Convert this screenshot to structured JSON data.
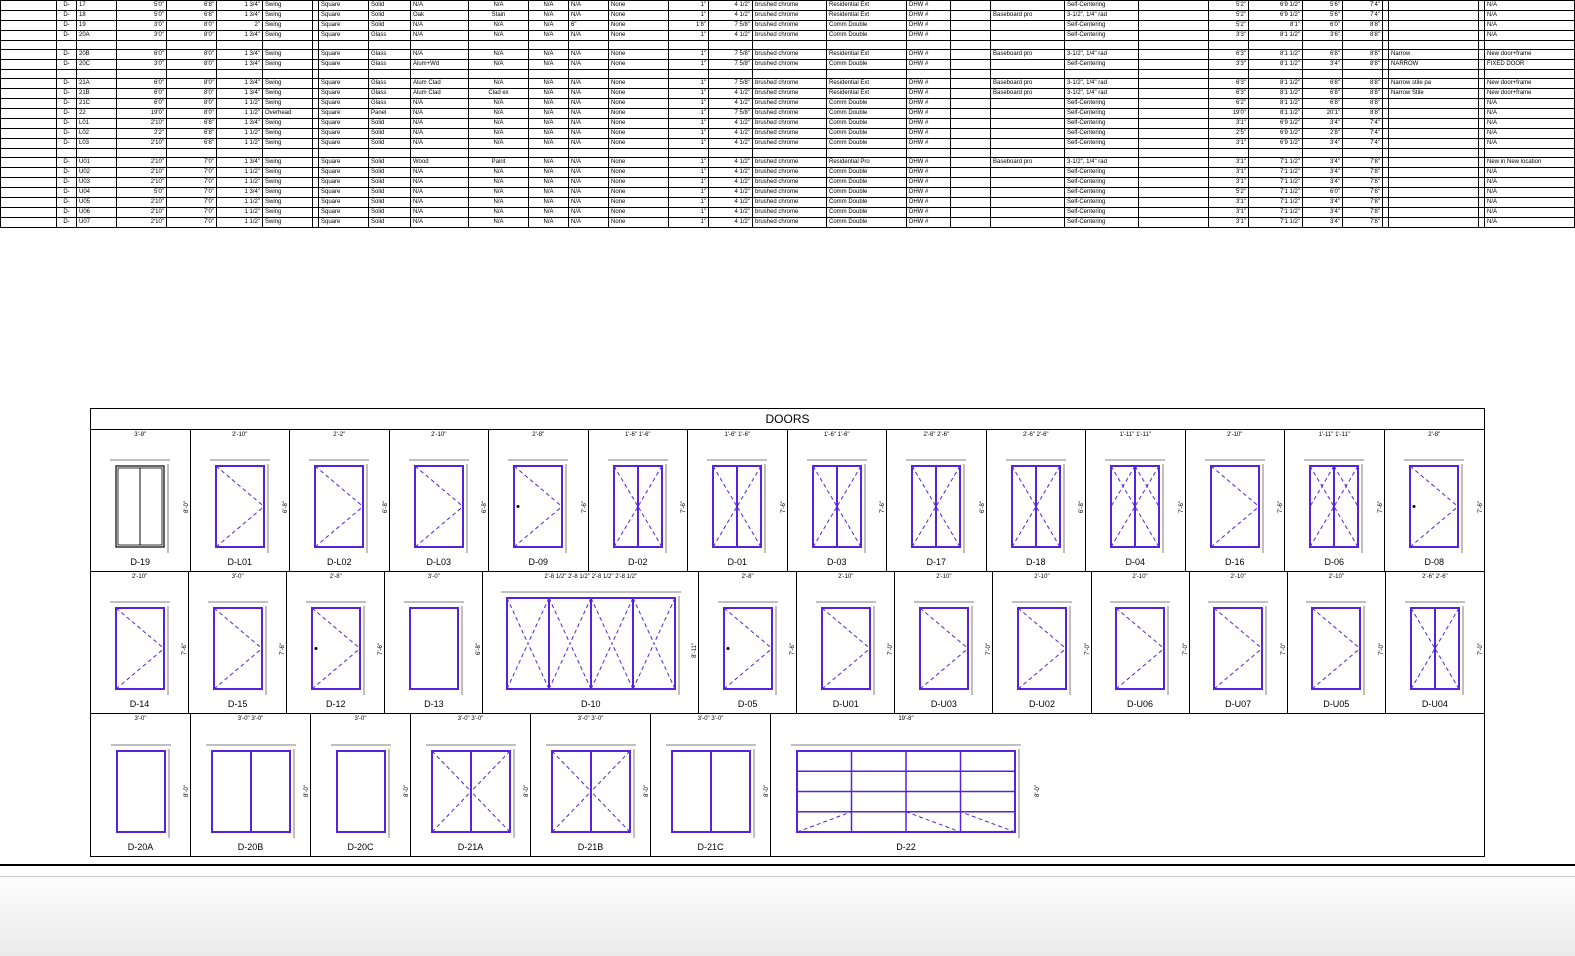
{
  "title": "DOORS",
  "schedule_rows": [
    {
      "p": "D-",
      "n": "17",
      "w": "5'0\"",
      "h": "6'8\"",
      "t": "1 3/4\"",
      "op": "Swing",
      "ty": "Square",
      "co": "Solid",
      "gl": "N/A",
      "f1": "N/A",
      "f2": "N/A",
      "f3": "N/A",
      "hw": "None",
      "fr": "1\"",
      "j1": "4 1/2\"",
      "j2": "brushed chrome",
      "j3": "Residential Ext",
      "h1": "DHW #",
      "h2": "",
      "hc": "Self-Centering",
      "bc": "",
      "d1": "5'2\"",
      "d2": "6'9 1/2\"",
      "d3": "5'6\"",
      "d4": "7'4\"",
      "rk": "",
      "note": "N/A"
    },
    {
      "p": "D-",
      "n": "18",
      "w": "5'0\"",
      "h": "6'8\"",
      "t": "1 3/4\"",
      "op": "Swing",
      "ty": "Square",
      "co": "Solid",
      "gl": "Oak",
      "f1": "Stain",
      "f2": "N/A",
      "f3": "N/A",
      "hw": "None",
      "fr": "1\"",
      "j1": "4 1/2\"",
      "j2": "brushed chrome",
      "j3": "Residential Ext",
      "h1": "DHW #",
      "h2": "Baseboard pro",
      "hc": "3-1/2\", 1/4\" rad",
      "bc": "",
      "d1": "5'2\"",
      "d2": "6'9 1/2\"",
      "d3": "5'6\"",
      "d4": "7'4\"",
      "rk": "",
      "note": "N/A"
    },
    {
      "p": "D-",
      "n": "19",
      "w": "3'0\"",
      "h": "8'0\"",
      "t": "2\"",
      "op": "Swing",
      "ty": "Square",
      "co": "Solid",
      "gl": "N/A",
      "f1": "N/A",
      "f2": "N/A",
      "f3": "6\"",
      "hw": "None",
      "fr": "1'8\"",
      "j1": "7 5/8\"",
      "j2": "brushed chrome",
      "j3": "Comm Double",
      "h1": "DHW #",
      "h2": "",
      "hc": "Self-Centering",
      "bc": "",
      "d1": "5'2\"",
      "d2": "8'1\"",
      "d3": "6'0\"",
      "d4": "8'8\"",
      "rk": "",
      "note": "N/A"
    },
    {
      "p": "D-",
      "n": "20A",
      "w": "3'0\"",
      "h": "8'0\"",
      "t": "1 3/4\"",
      "op": "Swing",
      "ty": "Square",
      "co": "Glass",
      "gl": "N/A",
      "f1": "N/A",
      "f2": "N/A",
      "f3": "N/A",
      "hw": "None",
      "fr": "1\"",
      "j1": "4 1/2\"",
      "j2": "brushed chrome",
      "j3": "Comm Double",
      "h1": "DHW #",
      "h2": "",
      "hc": "Self-Centering",
      "bc": "",
      "d1": "3'3\"",
      "d2": "8'1 1/2\"",
      "d3": "3'6\"",
      "d4": "8'8\"",
      "rk": "",
      "note": "N/A"
    },
    {
      "p": "D-",
      "n": "20B",
      "w": "6'0\"",
      "h": "8'0\"",
      "t": "1 3/4\"",
      "op": "Swing",
      "ty": "Square",
      "co": "Glass",
      "gl": "N/A",
      "f1": "N/A",
      "f2": "N/A",
      "f3": "N/A",
      "hw": "None",
      "fr": "1\"",
      "j1": "7 5/8\"",
      "j2": "brushed chrome",
      "j3": "Residential Ext",
      "h1": "DHW #",
      "h2": "Baseboard pro",
      "hc": "3-1/2\", 1/4\" rad",
      "bc": "",
      "d1": "6'3\"",
      "d2": "8'1 1/2\"",
      "d3": "6'8\"",
      "d4": "8'8\"",
      "rk": "Narrow",
      "note": "New door+frame"
    },
    {
      "p": "D-",
      "n": "20C",
      "w": "3'0\"",
      "h": "8'0\"",
      "t": "1 3/4\"",
      "op": "Swing",
      "ty": "Square",
      "co": "Glass",
      "gl": "Alum+Wd",
      "f1": "N/A",
      "f2": "N/A",
      "f3": "N/A",
      "hw": "None",
      "fr": "1\"",
      "j1": "7 5/8\"",
      "j2": "brushed chrome",
      "j3": "Comm Double",
      "h1": "DHW #",
      "h2": "",
      "hc": "Self-Centering",
      "bc": "",
      "d1": "3'3\"",
      "d2": "8'1 1/2\"",
      "d3": "3'4\"",
      "d4": "8'8\"",
      "rk": "NARROW",
      "note": "FIXED DOOR"
    },
    {
      "p": "D-",
      "n": "21A",
      "w": "6'0\"",
      "h": "8'0\"",
      "t": "1 3/4\"",
      "op": "Swing",
      "ty": "Square",
      "co": "Glass",
      "gl": "Alum Clad",
      "f1": "N/A",
      "f2": "N/A",
      "f3": "N/A",
      "hw": "None",
      "fr": "1\"",
      "j1": "7 5/8\"",
      "j2": "brushed chrome",
      "j3": "Residential Ext",
      "h1": "DHW #",
      "h2": "Baseboard pro",
      "hc": "3-1/2\", 1/4\" rad",
      "bc": "",
      "d1": "6'3\"",
      "d2": "8'1 1/2\"",
      "d3": "6'8\"",
      "d4": "8'8\"",
      "rk": "Narrow stile pa",
      "note": "New door+frame"
    },
    {
      "p": "D-",
      "n": "21B",
      "w": "6'0\"",
      "h": "8'0\"",
      "t": "1 3/4\"",
      "op": "Swing",
      "ty": "Square",
      "co": "Glass",
      "gl": "Alum Clad",
      "f1": "Clad ex",
      "f2": "N/A",
      "f3": "N/A",
      "hw": "None",
      "fr": "1\"",
      "j1": "4 1/2\"",
      "j2": "brushed chrome",
      "j3": "Residential Ext",
      "h1": "DHW #",
      "h2": "Baseboard pro",
      "hc": "3-1/2\", 1/4\" rad",
      "bc": "",
      "d1": "6'3\"",
      "d2": "8'1 1/2\"",
      "d3": "6'8\"",
      "d4": "8'8\"",
      "rk": "Narrow Stile",
      "note": "New door+frame"
    },
    {
      "p": "D-",
      "n": "21C",
      "w": "6'0\"",
      "h": "8'0\"",
      "t": "1 1/2\"",
      "op": "Swing",
      "ty": "Square",
      "co": "Glass",
      "gl": "N/A",
      "f1": "N/A",
      "f2": "N/A",
      "f3": "N/A",
      "hw": "None",
      "fr": "1\"",
      "j1": "4 1/2\"",
      "j2": "brushed chrome",
      "j3": "Comm Double",
      "h1": "DHW #",
      "h2": "",
      "hc": "Self-Centering",
      "bc": "",
      "d1": "6'2\"",
      "d2": "8'1 1/2\"",
      "d3": "6'8\"",
      "d4": "8'8\"",
      "rk": "",
      "note": "N/A"
    },
    {
      "p": "D-",
      "n": "22",
      "w": "19'0\"",
      "h": "8'0\"",
      "t": "1 1/2\"",
      "op": "Overhead",
      "ty": "Square",
      "co": "Panel",
      "gl": "N/A",
      "f1": "N/A",
      "f2": "N/A",
      "f3": "N/A",
      "hw": "None",
      "fr": "1\"",
      "j1": "7 5/8\"",
      "j2": "brushed chrome",
      "j3": "Comm Double",
      "h1": "DHW #",
      "h2": "",
      "hc": "Self-Centering",
      "bc": "",
      "d1": "19'0\"",
      "d2": "8'1 1/2\"",
      "d3": "20'1\"",
      "d4": "8'8\"",
      "rk": "",
      "note": "N/A"
    },
    {
      "p": "D-",
      "n": "L01",
      "w": "2'10\"",
      "h": "6'8\"",
      "t": "1 3/4\"",
      "op": "Swing",
      "ty": "Square",
      "co": "Solid",
      "gl": "N/A",
      "f1": "N/A",
      "f2": "N/A",
      "f3": "N/A",
      "hw": "None",
      "fr": "1\"",
      "j1": "4 1/2\"",
      "j2": "brushed chrome",
      "j3": "Comm Double",
      "h1": "DHW #",
      "h2": "",
      "hc": "Self-Centering",
      "bc": "",
      "d1": "3'1\"",
      "d2": "6'9 1/2\"",
      "d3": "3'4\"",
      "d4": "7'4\"",
      "rk": "",
      "note": "N/A"
    },
    {
      "p": "D-",
      "n": "L02",
      "w": "2'2\"",
      "h": "6'8\"",
      "t": "1 1/2\"",
      "op": "Swing",
      "ty": "Square",
      "co": "Solid",
      "gl": "N/A",
      "f1": "N/A",
      "f2": "N/A",
      "f3": "N/A",
      "hw": "None",
      "fr": "1\"",
      "j1": "4 1/2\"",
      "j2": "brushed chrome",
      "j3": "Comm Double",
      "h1": "DHW #",
      "h2": "",
      "hc": "Self-Centering",
      "bc": "",
      "d1": "2'5\"",
      "d2": "6'9 1/2\"",
      "d3": "2'8\"",
      "d4": "7'4\"",
      "rk": "",
      "note": "N/A"
    },
    {
      "p": "D-",
      "n": "L03",
      "w": "2'10\"",
      "h": "6'8\"",
      "t": "1 1/2\"",
      "op": "Swing",
      "ty": "Square",
      "co": "Solid",
      "gl": "N/A",
      "f1": "N/A",
      "f2": "N/A",
      "f3": "N/A",
      "hw": "None",
      "fr": "1\"",
      "j1": "4 1/2\"",
      "j2": "brushed chrome",
      "j3": "Comm Double",
      "h1": "DHW #",
      "h2": "",
      "hc": "Self-Centering",
      "bc": "",
      "d1": "3'1\"",
      "d2": "6'9 1/2\"",
      "d3": "3'4\"",
      "d4": "7'4\"",
      "rk": "",
      "note": "N/A"
    },
    {
      "p": "D-",
      "n": "U01",
      "w": "2'10\"",
      "h": "7'0\"",
      "t": "1 3/4\"",
      "op": "Swing",
      "ty": "Square",
      "co": "Solid",
      "gl": "Wood",
      "f1": "Paint",
      "f2": "N/A",
      "f3": "N/A",
      "hw": "None",
      "fr": "1\"",
      "j1": "4 1/2\"",
      "j2": "brushed chrome",
      "j3": "Residential Pro",
      "h1": "DHW #",
      "h2": "Baseboard pro",
      "hc": "3-1/2\", 1/4\" rad",
      "bc": "",
      "d1": "3'1\"",
      "d2": "7'1 1/2\"",
      "d3": "3'4\"",
      "d4": "7'8\"",
      "rk": "",
      "note": "New in New location"
    },
    {
      "p": "D-",
      "n": "U02",
      "w": "2'10\"",
      "h": "7'0\"",
      "t": "1 1/2\"",
      "op": "Swing",
      "ty": "Square",
      "co": "Solid",
      "gl": "N/A",
      "f1": "N/A",
      "f2": "N/A",
      "f3": "N/A",
      "hw": "None",
      "fr": "1\"",
      "j1": "4 1/2\"",
      "j2": "brushed chrome",
      "j3": "Comm Double",
      "h1": "DHW #",
      "h2": "",
      "hc": "Self-Centering",
      "bc": "",
      "d1": "3'1\"",
      "d2": "7'1 1/2\"",
      "d3": "3'4\"",
      "d4": "7'8\"",
      "rk": "",
      "note": "N/A"
    },
    {
      "p": "D-",
      "n": "U03",
      "w": "2'10\"",
      "h": "7'0\"",
      "t": "1 1/2\"",
      "op": "Swing",
      "ty": "Square",
      "co": "Solid",
      "gl": "N/A",
      "f1": "N/A",
      "f2": "N/A",
      "f3": "N/A",
      "hw": "None",
      "fr": "1\"",
      "j1": "4 1/2\"",
      "j2": "brushed chrome",
      "j3": "Comm Double",
      "h1": "DHW #",
      "h2": "",
      "hc": "Self-Centering",
      "bc": "",
      "d1": "3'1\"",
      "d2": "7'1 1/2\"",
      "d3": "3'4\"",
      "d4": "7'8\"",
      "rk": "",
      "note": "N/A"
    },
    {
      "p": "D-",
      "n": "U04",
      "w": "5'0\"",
      "h": "7'0\"",
      "t": "1 3/4\"",
      "op": "Swing",
      "ty": "Square",
      "co": "Solid",
      "gl": "N/A",
      "f1": "N/A",
      "f2": "N/A",
      "f3": "N/A",
      "hw": "None",
      "fr": "1\"",
      "j1": "4 1/2\"",
      "j2": "brushed chrome",
      "j3": "Comm Double",
      "h1": "DHW #",
      "h2": "",
      "hc": "Self-Centering",
      "bc": "",
      "d1": "5'2\"",
      "d2": "7'1 1/2\"",
      "d3": "6'0\"",
      "d4": "7'8\"",
      "rk": "",
      "note": "N/A"
    },
    {
      "p": "D-",
      "n": "U05",
      "w": "2'10\"",
      "h": "7'0\"",
      "t": "1 1/2\"",
      "op": "Swing",
      "ty": "Square",
      "co": "Solid",
      "gl": "N/A",
      "f1": "N/A",
      "f2": "N/A",
      "f3": "N/A",
      "hw": "None",
      "fr": "1\"",
      "j1": "4 1/2\"",
      "j2": "brushed chrome",
      "j3": "Comm Double",
      "h1": "DHW #",
      "h2": "",
      "hc": "Self-Centering",
      "bc": "",
      "d1": "3'1\"",
      "d2": "7'1 1/2\"",
      "d3": "3'4\"",
      "d4": "7'8\"",
      "rk": "",
      "note": "N/A"
    },
    {
      "p": "D-",
      "n": "U06",
      "w": "2'10\"",
      "h": "7'0\"",
      "t": "1 1/2\"",
      "op": "Swing",
      "ty": "Square",
      "co": "Solid",
      "gl": "N/A",
      "f1": "N/A",
      "f2": "N/A",
      "f3": "N/A",
      "hw": "None",
      "fr": "1\"",
      "j1": "4 1/2\"",
      "j2": "brushed chrome",
      "j3": "Comm Double",
      "h1": "DHW #",
      "h2": "",
      "hc": "Self-Centering",
      "bc": "",
      "d1": "3'1\"",
      "d2": "7'1 1/2\"",
      "d3": "3'4\"",
      "d4": "7'8\"",
      "rk": "",
      "note": "N/A"
    },
    {
      "p": "D-",
      "n": "U07",
      "w": "2'10\"",
      "h": "7'0\"",
      "t": "1 1/2\"",
      "op": "Swing",
      "ty": "Square",
      "co": "Solid",
      "gl": "N/A",
      "f1": "N/A",
      "f2": "N/A",
      "f3": "N/A",
      "hw": "None",
      "fr": "1\"",
      "j1": "4 1/2\"",
      "j2": "brushed chrome",
      "j3": "Comm Double",
      "h1": "DHW #",
      "h2": "",
      "hc": "Self-Centering",
      "bc": "",
      "d1": "3'1\"",
      "d2": "7'1 1/2\"",
      "d3": "3'4\"",
      "d4": "7'8\"",
      "rk": "",
      "note": "N/A"
    }
  ],
  "row1": [
    {
      "id": "D-19",
      "w": "3'-8\"",
      "h": "8'-0\"",
      "kind": "slider",
      "cls": "w1"
    },
    {
      "id": "D-L01",
      "w": "2'-10\"",
      "h": "6'-8\"",
      "kind": "single-rh",
      "cls": "w1"
    },
    {
      "id": "D-L02",
      "w": "2'-2\"",
      "h": "6'-8\"",
      "kind": "single-rh",
      "cls": "w1"
    },
    {
      "id": "D-L03",
      "w": "2'-10\"",
      "h": "6'-8\"",
      "kind": "single-rh",
      "cls": "w1"
    },
    {
      "id": "D-09",
      "w": "2'-8\"",
      "h": "7'-6\"",
      "kind": "single-dot",
      "cls": "w1"
    },
    {
      "id": "D-02",
      "w": "1'-6\"  1'-6\"",
      "h": "7'-6\"",
      "kind": "double",
      "cls": "w1"
    },
    {
      "id": "D-01",
      "w": "1'-6\"  1'-6\"",
      "h": "7'-6\"",
      "kind": "double",
      "cls": "w1"
    },
    {
      "id": "D-03",
      "w": "1'-6\"  1'-6\"",
      "h": "7'-6\"",
      "kind": "double",
      "cls": "w1"
    },
    {
      "id": "D-17",
      "w": "2'-6\"   2'-6\"",
      "h": "6'-8\"",
      "kind": "double",
      "cls": "w1"
    },
    {
      "id": "D-18",
      "w": "2'-6\"   2'-6\"",
      "h": "6'-8\"",
      "kind": "double",
      "cls": "w1"
    },
    {
      "id": "D-04",
      "w": "1'-11\"  1'-11\"",
      "h": "7'-6\"",
      "kind": "double-v",
      "cls": "w1"
    },
    {
      "id": "D-16",
      "w": "2'-10\"",
      "h": "7'-6\"",
      "kind": "single-rh",
      "cls": "w1"
    },
    {
      "id": "D-06",
      "w": "1'-11\"  1'-11\"",
      "h": "7'-6\"",
      "kind": "double-v",
      "cls": "w1"
    },
    {
      "id": "D-08",
      "w": "2'-8\"",
      "h": "7'-6\"",
      "kind": "single-dot",
      "cls": "w1"
    }
  ],
  "row2": [
    {
      "id": "D-14",
      "w": "2'-10\"",
      "h": "7'-6\"",
      "kind": "single-rh",
      "cls": "w1"
    },
    {
      "id": "D-15",
      "w": "3'-0\"",
      "h": "7'-6\"",
      "kind": "single-rh",
      "cls": "w1"
    },
    {
      "id": "D-12",
      "w": "2'-8\"",
      "h": "7'-6\"",
      "kind": "single-dot",
      "cls": "w1"
    },
    {
      "id": "D-13",
      "w": "3'-0\"",
      "h": "6'-8\"",
      "kind": "plain",
      "cls": "w1"
    },
    {
      "id": "D-10",
      "w": "2'-8 1/2\"  2'-8 1/2\"  2'-8 1/2\"  2'-8 1/2\"",
      "h": "8'-11\"",
      "kind": "quad",
      "cls": "w3"
    },
    {
      "id": "D-05",
      "w": "2'-8\"",
      "h": "7'-6\"",
      "kind": "single-dot",
      "cls": "w1"
    },
    {
      "id": "D-U01",
      "w": "2'-10\"",
      "h": "7'-0\"",
      "kind": "single-rh",
      "cls": "w1"
    },
    {
      "id": "D-U03",
      "w": "2'-10\"",
      "h": "7'-0\"",
      "kind": "single-rh",
      "cls": "w1"
    },
    {
      "id": "D-U02",
      "w": "2'-10\"",
      "h": "7'-0\"",
      "kind": "single-rh",
      "cls": "w1"
    },
    {
      "id": "D-U06",
      "w": "2'-10\"",
      "h": "7'-0\"",
      "kind": "single-rh",
      "cls": "w1"
    },
    {
      "id": "D-U07",
      "w": "2'-10\"",
      "h": "7'-0\"",
      "kind": "single-rh",
      "cls": "w1"
    },
    {
      "id": "D-U05",
      "w": "2'-10\"",
      "h": "7'-0\"",
      "kind": "single-rh",
      "cls": "w1"
    },
    {
      "id": "D-U04",
      "w": "2'-6\"   2'-6\"",
      "h": "7'-0\"",
      "kind": "double",
      "cls": "w1"
    }
  ],
  "row3": [
    {
      "id": "D-20A",
      "w": "3'-0\"",
      "h": "8'-0\"",
      "kind": "plain",
      "cls": "w1"
    },
    {
      "id": "D-20B",
      "w": "3'-0\"   3'-0\"",
      "h": "8'-0\"",
      "kind": "plain-double",
      "cls": "w2"
    },
    {
      "id": "D-20C",
      "w": "3'-0\"",
      "h": "8'-0\"",
      "kind": "plain",
      "cls": "w1"
    },
    {
      "id": "D-21A",
      "w": "3'-0\"   3'-0\"",
      "h": "8'-0\"",
      "kind": "double",
      "cls": "w2"
    },
    {
      "id": "D-21B",
      "w": "3'-0\"   3'-0\"",
      "h": "8'-0\"",
      "kind": "double",
      "cls": "w2"
    },
    {
      "id": "D-21C",
      "w": "3'-0\"   3'-0\"",
      "h": "8'-0\"",
      "kind": "plain-double",
      "cls": "w2"
    },
    {
      "id": "D-22",
      "w": "19'-8\"",
      "h": "8'-0\"",
      "kind": "sectional",
      "cls": "w4"
    }
  ]
}
